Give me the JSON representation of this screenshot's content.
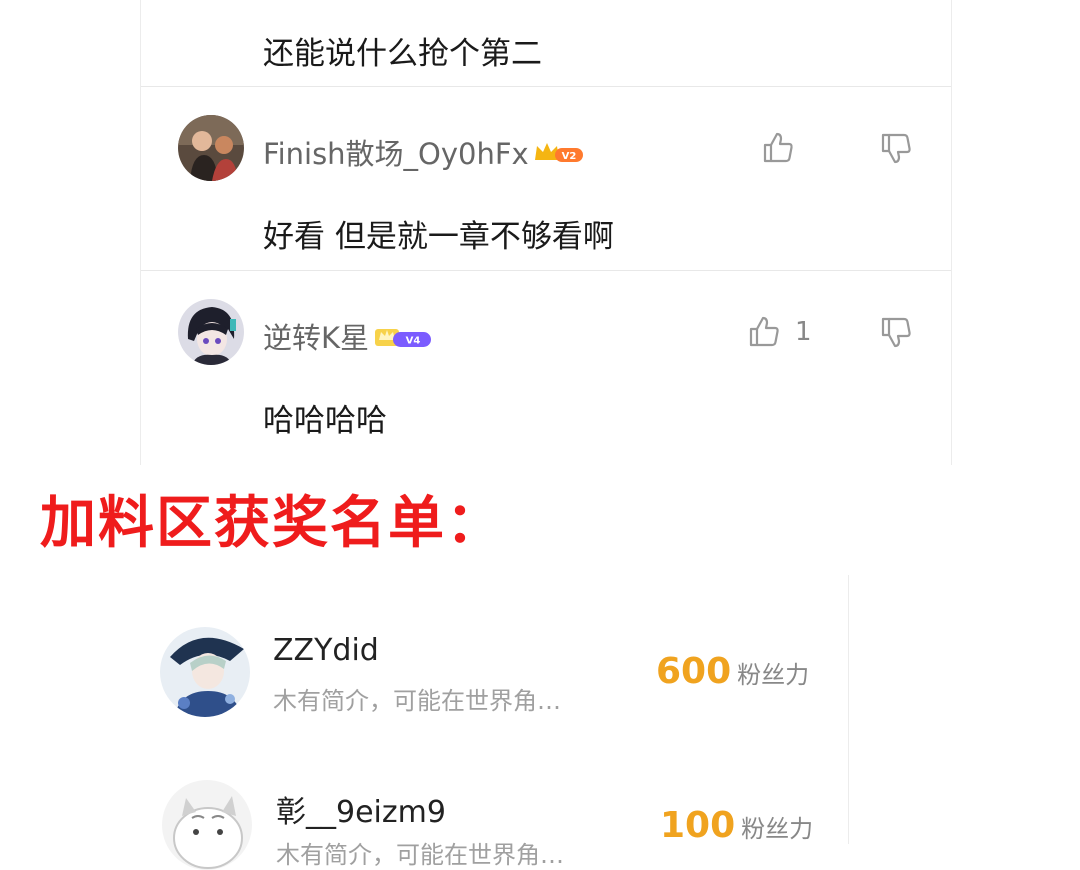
{
  "comments": [
    {
      "text": "还能说什么抢个第二"
    },
    {
      "username": "Finish散场_Oy0hFx",
      "level": "V2",
      "text": "好看 但是就一章不够看啊",
      "likes": ""
    },
    {
      "username": "逆转K星",
      "level": "V4",
      "text": "哈哈哈哈",
      "likes": "1"
    }
  ],
  "section_title": "加料区获奖名单：",
  "fans": [
    {
      "name": "ZZYdid",
      "desc": "木有简介，可能在世界角…",
      "amount": "600",
      "unit": "粉丝力"
    },
    {
      "name": "彰__9eizm9",
      "desc": "木有简介，可能在世界角…",
      "amount": "100",
      "unit": "粉丝力"
    }
  ],
  "colors": {
    "title": "#ef1c1c",
    "amount": "#f0a31f",
    "v2_badge": "#ff7a2e",
    "v4_badge": "#7b5cff"
  }
}
